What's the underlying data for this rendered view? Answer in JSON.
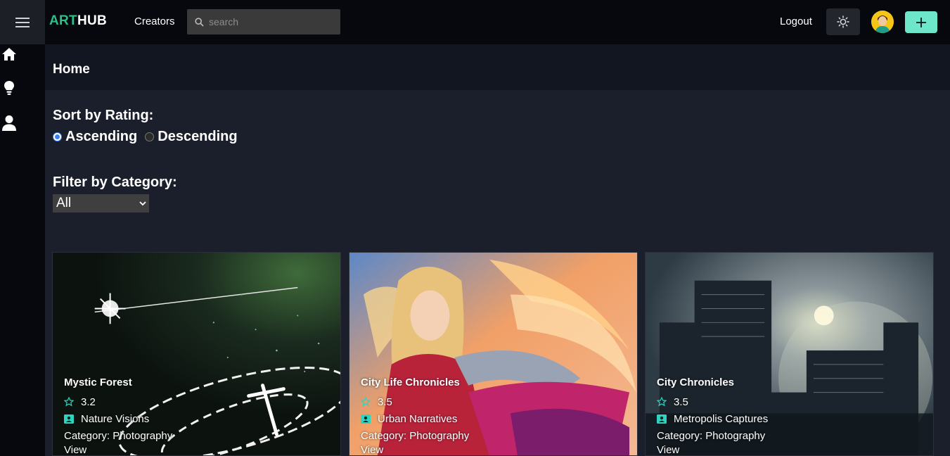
{
  "header": {
    "logo_part1": "ART",
    "logo_part2": "HUB",
    "nav_creators": "Creators",
    "search_placeholder": "search",
    "logout": "Logout"
  },
  "sidebar": {
    "items": [
      {
        "icon": "home-icon"
      },
      {
        "icon": "lightbulb-icon"
      },
      {
        "icon": "user-icon"
      }
    ]
  },
  "page": {
    "title": "Home",
    "sort_label": "Sort by Rating:",
    "sort_options": [
      "Ascending",
      "Descending"
    ],
    "sort_selected": "Ascending",
    "filter_label": "Filter by Category:",
    "filter_value": "All"
  },
  "cards": [
    {
      "title": "Mystic Forest",
      "rating": "3.2",
      "collection": "Nature Visions",
      "category": "Category: Photography",
      "view": "View"
    },
    {
      "title": "City Life Chronicles",
      "rating": "3.5",
      "collection": "Urban Narratives",
      "category": "Category: Photography",
      "view": "View"
    },
    {
      "title": "City Chronicles",
      "rating": "3.5",
      "collection": "Metropolis Captures",
      "category": "Category: Photography",
      "view": "View"
    }
  ],
  "colors": {
    "brand_green": "#2fbf87",
    "accent_teal": "#6ee6c9",
    "star_teal": "#2dd4bf",
    "radio_blue": "#3b82f6"
  }
}
